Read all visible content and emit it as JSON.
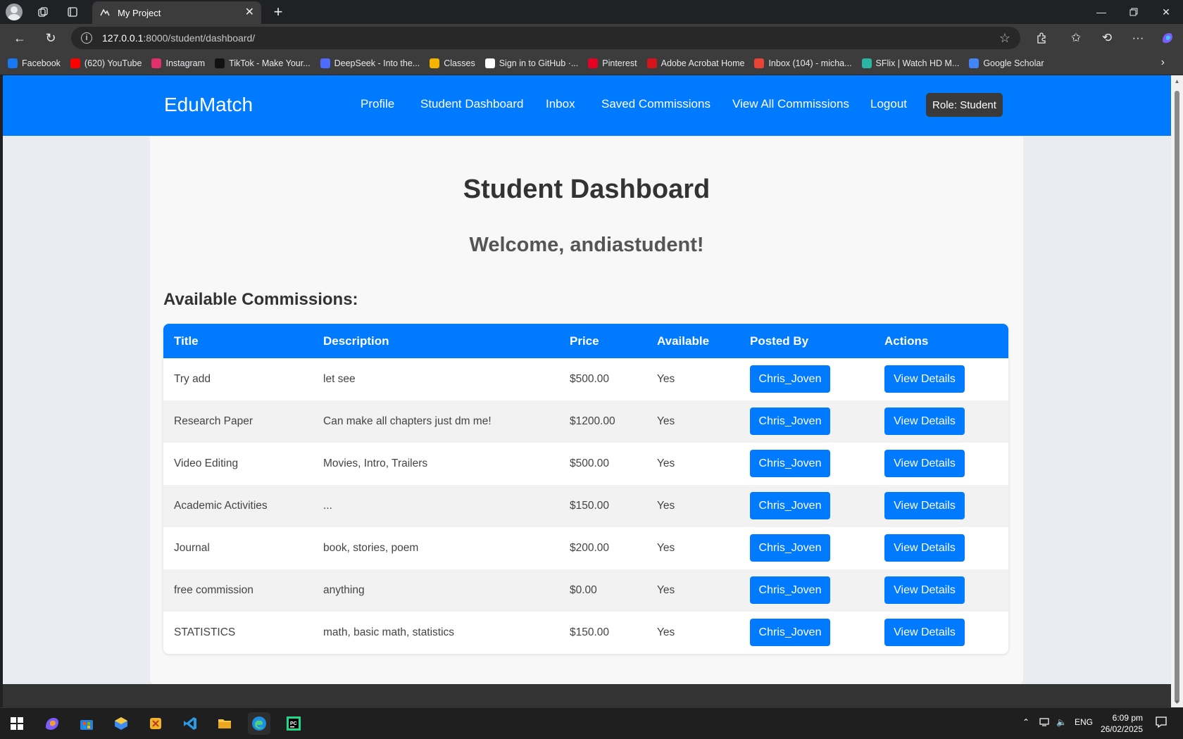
{
  "browser": {
    "tab_title": "My Project",
    "url_host": "127.0.0.1",
    "url_rest": ":8000/student/dashboard/",
    "bookmarks": [
      {
        "label": "Facebook",
        "color": "#1877f2"
      },
      {
        "label": "(620) YouTube",
        "color": "#ff0000"
      },
      {
        "label": "Instagram",
        "color": "#e1306c"
      },
      {
        "label": "TikTok - Make Your...",
        "color": "#111111"
      },
      {
        "label": "DeepSeek - Into the...",
        "color": "#4d6bfe"
      },
      {
        "label": "Classes",
        "color": "#f4b400"
      },
      {
        "label": "Sign in to GitHub ·...",
        "color": "#ffffff"
      },
      {
        "label": "Pinterest",
        "color": "#e60023"
      },
      {
        "label": "Adobe Acrobat Home",
        "color": "#d4161c"
      },
      {
        "label": "Inbox (104) - micha...",
        "color": "#ea4335"
      },
      {
        "label": "SFlix | Watch HD M...",
        "color": "#2bb5a5"
      },
      {
        "label": "Google Scholar",
        "color": "#4285f4"
      }
    ]
  },
  "navbar": {
    "brand": "EduMatch",
    "links": [
      "Profile",
      "Student Dashboard",
      "Inbox",
      "Saved Commissions",
      "View All Commissions",
      "Logout"
    ],
    "role_badge": "Role: Student"
  },
  "main": {
    "title": "Student Dashboard",
    "welcome": "Welcome, andiastudent!",
    "section_title": "Available Commissions:"
  },
  "table": {
    "headers": [
      "Title",
      "Description",
      "Price",
      "Available",
      "Posted By",
      "Actions"
    ],
    "rows": [
      {
        "title": "Try add",
        "description": "let see",
        "price": "$500.00",
        "available": "Yes",
        "posted_by": "Chris_Joven",
        "action": "View Details"
      },
      {
        "title": "Research Paper",
        "description": "Can make all chapters just dm me!",
        "price": "$1200.00",
        "available": "Yes",
        "posted_by": "Chris_Joven",
        "action": "View Details"
      },
      {
        "title": "Video Editing",
        "description": "Movies, Intro, Trailers",
        "price": "$500.00",
        "available": "Yes",
        "posted_by": "Chris_Joven",
        "action": "View Details"
      },
      {
        "title": "Academic Activities",
        "description": "...",
        "price": "$150.00",
        "available": "Yes",
        "posted_by": "Chris_Joven",
        "action": "View Details"
      },
      {
        "title": "Journal",
        "description": "book, stories, poem",
        "price": "$200.00",
        "available": "Yes",
        "posted_by": "Chris_Joven",
        "action": "View Details"
      },
      {
        "title": "free commission",
        "description": "anything",
        "price": "$0.00",
        "available": "Yes",
        "posted_by": "Chris_Joven",
        "action": "View Details"
      },
      {
        "title": "STATISTICS",
        "description": "math, basic math, statistics",
        "price": "$150.00",
        "available": "Yes",
        "posted_by": "Chris_Joven",
        "action": "View Details"
      }
    ]
  },
  "taskbar": {
    "language": "ENG",
    "time": "6:09 pm",
    "date": "26/02/2025"
  },
  "colors": {
    "primary": "#007bff",
    "dark": "#333333"
  }
}
